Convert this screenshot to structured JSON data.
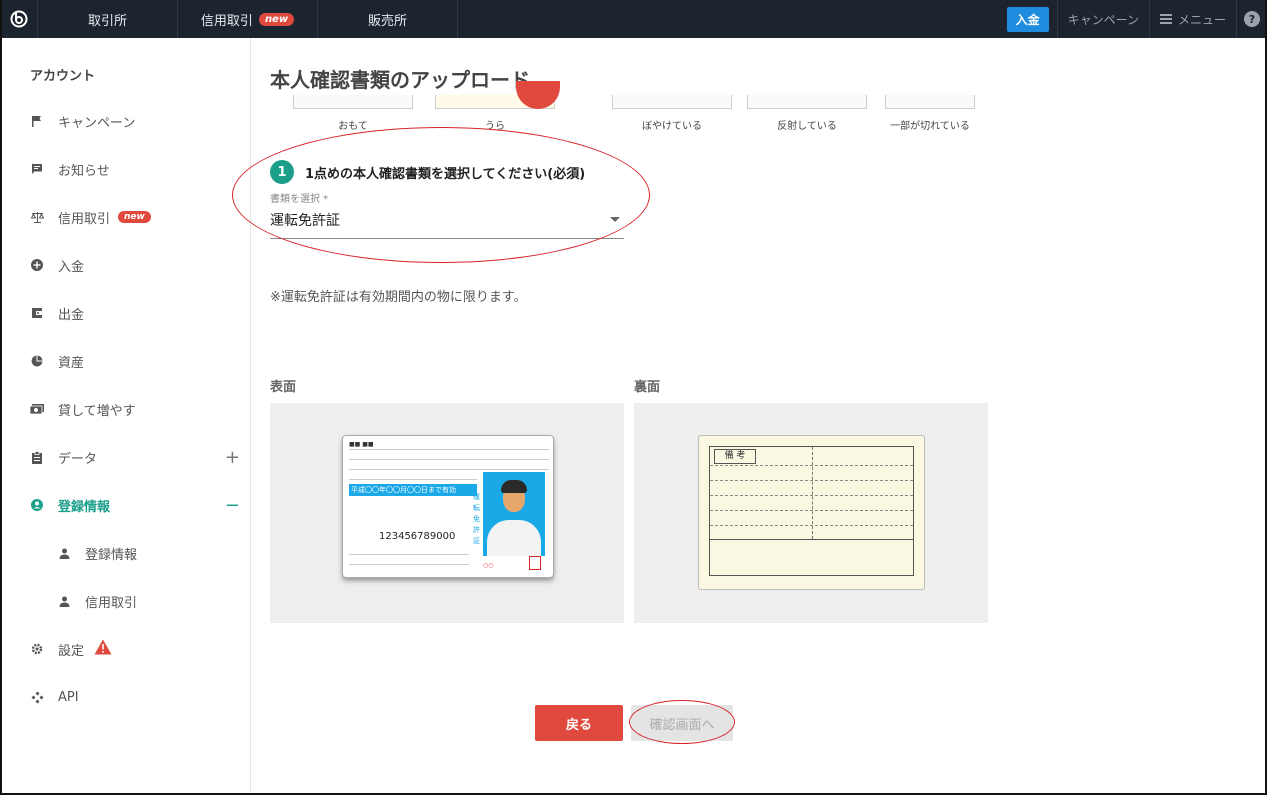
{
  "topbar": {
    "tabs": [
      {
        "label": "取引所"
      },
      {
        "label": "信用取引",
        "badge": "new"
      },
      {
        "label": "販売所"
      }
    ],
    "deposit_label": "入金",
    "campaign_label": "キャンペーン",
    "menu_label": "メニュー",
    "help_label": "?"
  },
  "sidebar": {
    "title": "アカウント",
    "items": [
      {
        "label": "キャンペーン",
        "icon": "flag-icon"
      },
      {
        "label": "お知らせ",
        "icon": "message-icon"
      },
      {
        "label": "信用取引",
        "icon": "scale-icon",
        "badge": "new"
      },
      {
        "label": "入金",
        "icon": "plus-circle-icon"
      },
      {
        "label": "出金",
        "icon": "wallet-icon"
      },
      {
        "label": "資産",
        "icon": "pie-chart-icon"
      },
      {
        "label": "貸して増やす",
        "icon": "cash-icon"
      },
      {
        "label": "データ",
        "icon": "clipboard-icon",
        "toggle": "+"
      },
      {
        "label": "登録情報",
        "icon": "account-circle-icon",
        "toggle": "−",
        "active": true
      },
      {
        "label": "登録情報",
        "icon": "person-icon",
        "sub": true
      },
      {
        "label": "信用取引",
        "icon": "person-icon",
        "sub": true
      },
      {
        "label": "設定",
        "icon": "gear-icon",
        "warning": true
      },
      {
        "label": "API",
        "icon": "api-icon"
      }
    ]
  },
  "main": {
    "title": "本人確認書類のアップロード",
    "examples": {
      "labels": [
        "おもて",
        "うら",
        "ぼやけている",
        "反射している",
        "一部が切れている"
      ]
    },
    "step": {
      "number": "1",
      "text": "1点めの本人確認書類を選択してください(必須)"
    },
    "select": {
      "label": "書類を選択 *",
      "value": "運転免許証"
    },
    "note": "※運転免許証は有効期間内の物に限ります。",
    "front_label": "表面",
    "back_label": "裏面",
    "license_front": {
      "bar_text": "平成〇〇年〇〇月〇〇日まで有効",
      "number": "123456789000",
      "vertical_text": "運転免許証"
    },
    "license_back": {
      "box_label": "備 考"
    },
    "buttons": {
      "back": "戻る",
      "confirm": "確認画面へ"
    },
    "colors": {
      "accent": "#1b9e8a",
      "danger": "#e04a3e",
      "annotation": "#d8232a"
    }
  }
}
